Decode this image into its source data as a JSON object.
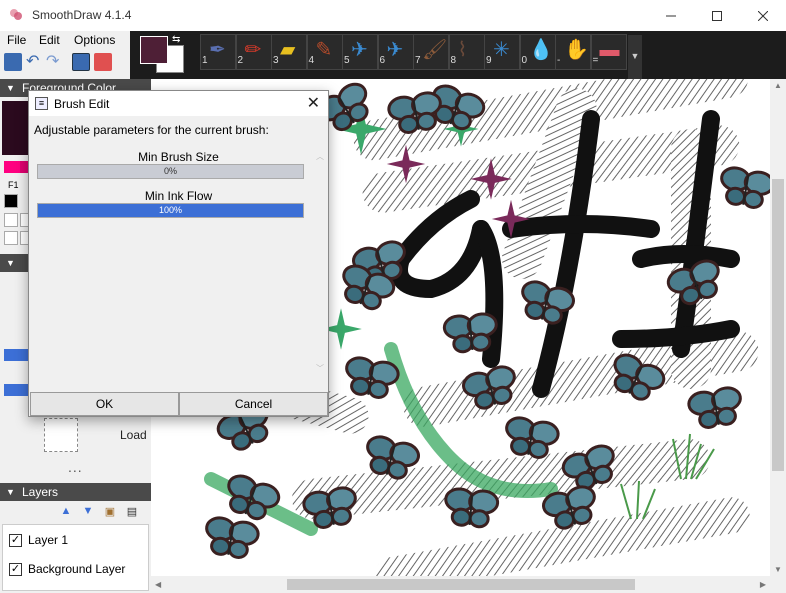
{
  "app": {
    "title": "SmoothDraw 4.1.4"
  },
  "menu": [
    {
      "label": "File"
    },
    {
      "label": "Edit"
    },
    {
      "label": "Options"
    }
  ],
  "brushes": [
    {
      "num": "1",
      "icon": "pen-icon",
      "color": "#5a6fb0"
    },
    {
      "num": "2",
      "icon": "pencil-icon",
      "color": "#d43a2a"
    },
    {
      "num": "3",
      "icon": "highlighter-icon",
      "color": "#e8c020"
    },
    {
      "num": "4",
      "icon": "brush-icon",
      "color": "#b04a2a"
    },
    {
      "num": "5",
      "icon": "airbrush-icon",
      "color": "#3a8ad0"
    },
    {
      "num": "6",
      "icon": "airbrush-icon",
      "color": "#3a8ad0"
    },
    {
      "num": "7",
      "icon": "paintbrush-icon",
      "color": "#8a5a3a"
    },
    {
      "num": "8",
      "icon": "flat-brush-icon",
      "color": "#6a4a3a"
    },
    {
      "num": "9",
      "icon": "sparkle-icon",
      "color": "#3a8ad0"
    },
    {
      "num": "0",
      "icon": "water-drop-icon",
      "color": "#3a8ad0"
    },
    {
      "num": "-",
      "icon": "hand-icon",
      "color": "#e8a040"
    },
    {
      "num": "=",
      "icon": "eraser-icon",
      "color": "#e05a6a"
    }
  ],
  "foreground_color": "#4e1f36",
  "background_color": "#ffffff",
  "panels": {
    "foreground_color_label": "Foreground Color",
    "palette_tab": "F1",
    "layers_label": "Layers",
    "load_label": "Load",
    "ellipsis": "..."
  },
  "palette_colors": [
    "#ff0080",
    "#e00070"
  ],
  "layers": [
    {
      "name": "Layer 1",
      "checked": true
    },
    {
      "name": "Background Layer",
      "checked": true
    }
  ],
  "dialog": {
    "title": "Brush Edit",
    "description": "Adjustable parameters for the current brush:",
    "params": [
      {
        "label": "Min Brush Size",
        "value_text": "0%",
        "value": 0
      },
      {
        "label": "Min Ink Flow",
        "value_text": "100%",
        "value": 100
      }
    ],
    "ok_label": "OK",
    "cancel_label": "Cancel"
  },
  "accent_color": "#3c6fd6"
}
